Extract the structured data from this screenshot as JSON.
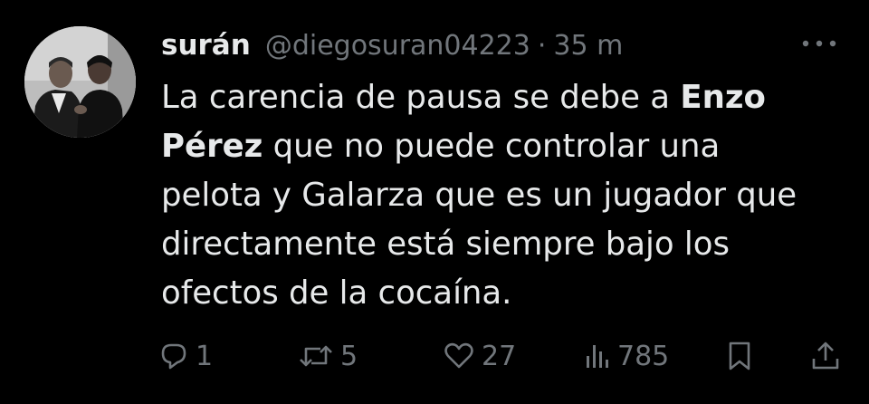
{
  "tweet": {
    "display_name": "surán",
    "handle": "@diegosuran04223",
    "separator": "·",
    "time": "35 m",
    "text": {
      "part1": "La carencia de pausa se debe a ",
      "bold": "Enzo Pérez",
      "part2": " que no puede controlar una pelota y Galarza que es un jugador que directamente está siempre bajo los ofectos de la cocaína."
    },
    "actions": {
      "replies": "1",
      "retweets": "5",
      "likes": "27",
      "views": "785"
    }
  },
  "icons": {
    "more": "more-dots-icon",
    "reply": "reply-bubble-icon",
    "retweet": "retweet-icon",
    "like": "heart-icon",
    "views": "bar-chart-icon",
    "bookmark": "bookmark-icon",
    "share": "share-upload-icon"
  },
  "colors": {
    "background": "#000000",
    "text_primary": "#e7e9ea",
    "text_secondary": "#71767b"
  }
}
